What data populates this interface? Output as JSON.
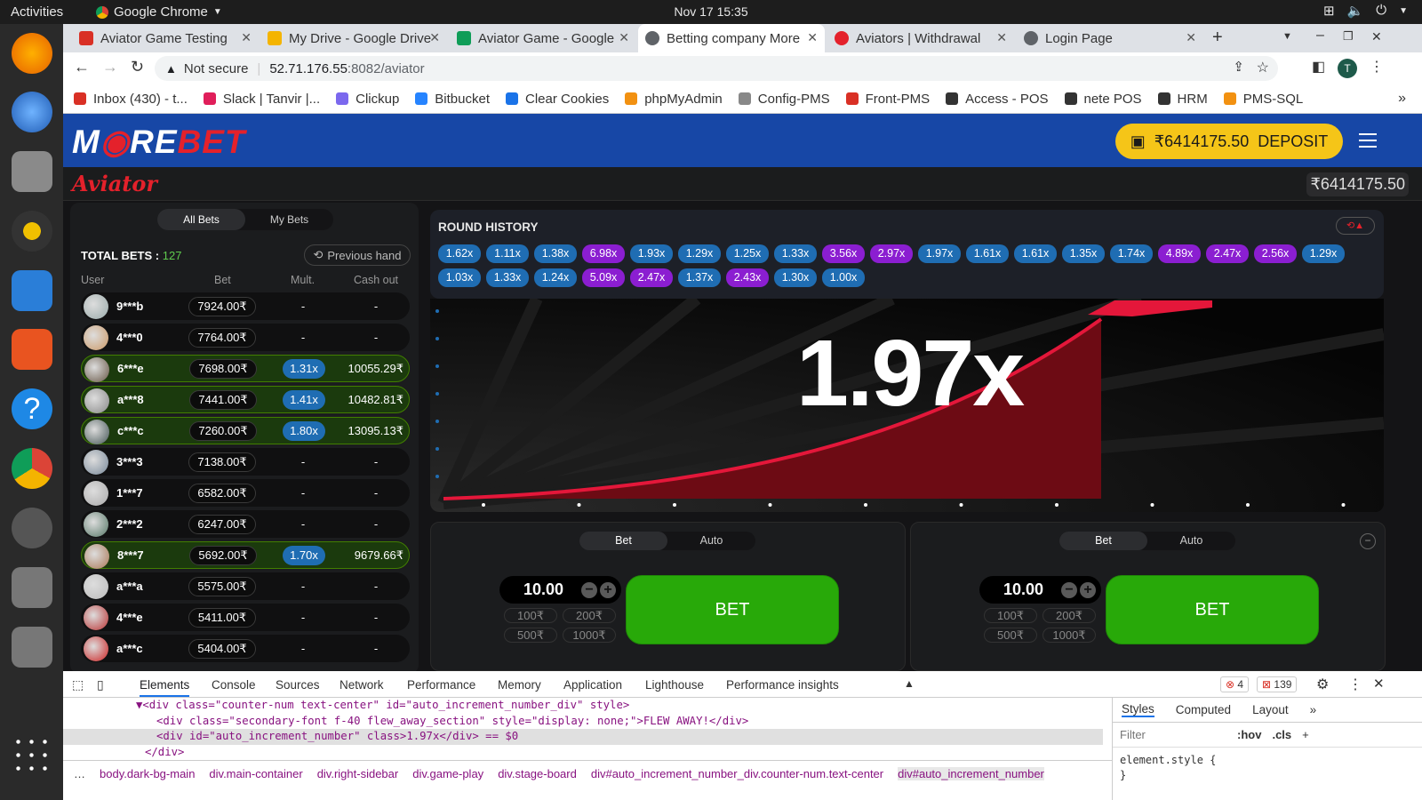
{
  "os": {
    "activities": "Activities",
    "app_name": "Google Chrome",
    "clock": "Nov 17  15:35"
  },
  "browser": {
    "tabs": [
      {
        "title": "Aviator Game Testing",
        "fav_color": "#d93025"
      },
      {
        "title": "My Drive - Google Drive",
        "fav_color": "#f4b400"
      },
      {
        "title": "Aviator Game - Google",
        "fav_color": "#0f9d58"
      },
      {
        "title": "Betting company More",
        "fav_color": "#5f6368"
      },
      {
        "title": "Aviators | Withdrawal",
        "fav_color": "#e4212b"
      },
      {
        "title": "Login Page",
        "fav_color": "#5f6368"
      }
    ],
    "security": "Not secure",
    "url_host": "52.71.176.55",
    "url_rest": ":8082/aviator",
    "profile_initial": "T",
    "bookmarks": [
      "Inbox (430) - t...",
      "Slack | Tanvir |...",
      "Clickup",
      "Bitbucket",
      "Clear Cookies",
      "phpMyAdmin",
      "Config-PMS",
      "Front-PMS",
      "Access - POS",
      "nete POS",
      "HRM",
      "PMS-SQL"
    ]
  },
  "site": {
    "logo_a": "M",
    "logo_b": "RE",
    "logo_c": "BET",
    "deposit_amount": "₹6414175.50",
    "deposit_label": "DEPOSIT",
    "game_logo": "Aviator",
    "balance": "₹6414175.50"
  },
  "bets": {
    "tab_all": "All Bets",
    "tab_my": "My Bets",
    "total_label": "TOTAL BETS : ",
    "total_value": "127",
    "prev_hand": "Previous hand",
    "col_user": "User",
    "col_bet": "Bet",
    "col_mult": "Mult.",
    "col_cash": "Cash out",
    "rows": [
      {
        "user": "9***b",
        "bet": "7924.00₹",
        "mult": "-",
        "cash": "-",
        "win": false
      },
      {
        "user": "4***0",
        "bet": "7764.00₹",
        "mult": "-",
        "cash": "-",
        "win": false
      },
      {
        "user": "6***e",
        "bet": "7698.00₹",
        "mult": "1.31x",
        "cash": "10055.29₹",
        "win": true
      },
      {
        "user": "a***8",
        "bet": "7441.00₹",
        "mult": "1.41x",
        "cash": "10482.81₹",
        "win": true
      },
      {
        "user": "c***c",
        "bet": "7260.00₹",
        "mult": "1.80x",
        "cash": "13095.13₹",
        "win": true
      },
      {
        "user": "3***3",
        "bet": "7138.00₹",
        "mult": "-",
        "cash": "-",
        "win": false
      },
      {
        "user": "1***7",
        "bet": "6582.00₹",
        "mult": "-",
        "cash": "-",
        "win": false
      },
      {
        "user": "2***2",
        "bet": "6247.00₹",
        "mult": "-",
        "cash": "-",
        "win": false
      },
      {
        "user": "8***7",
        "bet": "5692.00₹",
        "mult": "1.70x",
        "cash": "9679.66₹",
        "win": true
      },
      {
        "user": "a***a",
        "bet": "5575.00₹",
        "mult": "-",
        "cash": "-",
        "win": false
      },
      {
        "user": "4***e",
        "bet": "5411.00₹",
        "mult": "-",
        "cash": "-",
        "win": false
      },
      {
        "user": "a***c",
        "bet": "5404.00₹",
        "mult": "-",
        "cash": "-",
        "win": false
      }
    ]
  },
  "history": {
    "title": "ROUND HISTORY",
    "values": [
      "1.62x",
      "1.11x",
      "1.38x",
      "6.98x",
      "1.93x",
      "1.29x",
      "1.25x",
      "1.33x",
      "3.56x",
      "2.97x",
      "1.97x",
      "1.61x",
      "1.61x",
      "1.35x",
      "1.74x",
      "4.89x",
      "2.47x",
      "2.56x",
      "1.29x",
      "1.03x",
      "1.33x",
      "1.24x",
      "5.09x",
      "2.47x",
      "1.37x",
      "2.43x",
      "1.30x",
      "1.00x"
    ]
  },
  "game": {
    "multiplier": "1.97x"
  },
  "panels": [
    {
      "tab_bet": "Bet",
      "tab_auto": "Auto",
      "amount": "10.00",
      "quick": [
        "100₹",
        "200₹",
        "500₹",
        "1000₹"
      ],
      "bet_label": "BET"
    },
    {
      "tab_bet": "Bet",
      "tab_auto": "Auto",
      "amount": "10.00",
      "quick": [
        "100₹",
        "200₹",
        "500₹",
        "1000₹"
      ],
      "bet_label": "BET"
    }
  ],
  "devtools": {
    "tabs": [
      "Elements",
      "Console",
      "Sources",
      "Network",
      "Performance",
      "Memory",
      "Application",
      "Lighthouse",
      "Performance insights"
    ],
    "errors": "4",
    "warnings": "139",
    "code": [
      "▼<div class=\"counter-num text-center\" id=\"auto_increment_number_div\" style>",
      "<div class=\"secondary-font f-40 flew_away_section\" style=\"display: none;\">FLEW AWAY!</div>",
      "<div id=\"auto_increment_number\" class>1.97x</div> == $0",
      "</div>"
    ],
    "crumbs": [
      "body.dark-bg-main",
      "div.main-container",
      "div.right-sidebar",
      "div.game-play",
      "div.stage-board",
      "div#auto_increment_number_div.counter-num.text-center",
      "div#auto_increment_number"
    ],
    "styles_tabs": [
      "Styles",
      "Computed",
      "Layout"
    ],
    "filter_placeholder": "Filter",
    "hov": ":hov",
    "cls": ".cls",
    "element_style": "element.style {",
    "close_brace": "}"
  }
}
